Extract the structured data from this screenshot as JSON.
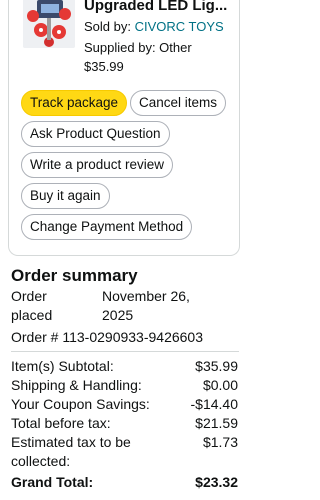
{
  "order_item": {
    "title": "Upgraded LED Lig...",
    "sold_by_prefix": "Sold by: ",
    "seller": "CIVORC TOYS",
    "supplied_by": "Supplied by: Other",
    "price": "$35.99",
    "thumbnail_icon": "toy-robot-kit-icon"
  },
  "actions": {
    "track_package": "Track package",
    "cancel_items": "Cancel items",
    "ask_question": "Ask Product Question",
    "write_review": "Write a product review",
    "buy_again": "Buy it again",
    "change_payment": "Change Payment Method"
  },
  "summary": {
    "title": "Order summary",
    "order_placed_label_1": "Order",
    "order_placed_label_2": "placed",
    "order_date_1": "November 26,",
    "order_date_2": "2025",
    "order_number": "Order # 113-0290933-9426603",
    "rows": [
      {
        "label": "Item(s) Subtotal:",
        "value": "$35.99"
      },
      {
        "label": "Shipping & Handling:",
        "value": "$0.00"
      },
      {
        "label": "Your Coupon Savings:",
        "value": "-$14.40"
      },
      {
        "label": "Total before tax:",
        "value": "$21.59"
      }
    ],
    "tax_label_1": "Estimated tax to be",
    "tax_label_2": "collected:",
    "tax_value": "$1.73",
    "grand_total_label": "Grand Total:",
    "grand_total_value": "$23.32"
  },
  "colors": {
    "primary_button": "#ffd814",
    "link": "#007185",
    "accent_red": "#e53935"
  }
}
